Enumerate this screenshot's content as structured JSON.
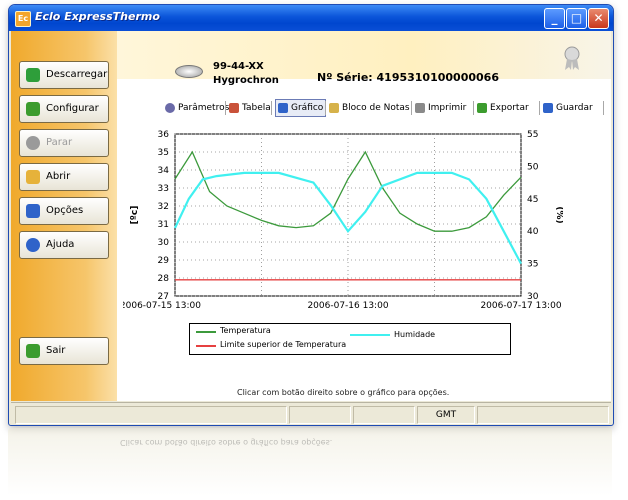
{
  "window": {
    "title": "Eclo ExpressThermo",
    "app_icon": "Ec"
  },
  "title_buttons": {
    "minimize": "_",
    "maximize": "□",
    "close": "✕"
  },
  "sidebar": {
    "items": [
      {
        "label": "Descarregar",
        "icon": "download-icon",
        "color": "#2e9e3a"
      },
      {
        "label": "Configurar",
        "icon": "configure-icon",
        "color": "#3c9c2e"
      },
      {
        "label": "Parar",
        "icon": "stop-icon",
        "color": "#9a9a9a",
        "disabled": true
      },
      {
        "label": "Abrir",
        "icon": "open-folder-icon",
        "color": "#e6b23a"
      },
      {
        "label": "Opções",
        "icon": "options-checkbox-icon",
        "color": "#2f63c9"
      },
      {
        "label": "Ajuda",
        "icon": "help-icon",
        "color": "#2f63c9"
      }
    ],
    "exit_label": "Sair"
  },
  "device": {
    "id": "99-44-XX",
    "name": "Hygrochron",
    "serial": "Nº Série: 4195310100000066"
  },
  "toolbar": {
    "items": [
      {
        "label": "Parâmetros",
        "icon": "gear-icon",
        "color": "#6a6aa8"
      },
      {
        "label": "Tabela",
        "icon": "table-icon",
        "color": "#c9523a"
      },
      {
        "label": "Gráfico",
        "icon": "chart-icon",
        "color": "#2f63c9",
        "active": true
      },
      {
        "label": "Bloco de Notas",
        "icon": "notepad-icon",
        "color": "#d6b24a"
      },
      {
        "label": "Imprimir",
        "icon": "printer-icon",
        "color": "#8a8a8a"
      },
      {
        "label": "Exportar",
        "icon": "export-icon",
        "color": "#3c9c2e"
      },
      {
        "label": "Guardar",
        "icon": "save-icon",
        "color": "#2f63c9"
      }
    ]
  },
  "chart_data": {
    "type": "line",
    "x_ticks": [
      "2006-07-15 13:00",
      "2006-07-16 13:00",
      "2006-07-17 13:00"
    ],
    "y_left": {
      "label": "[ºc]",
      "min": 27,
      "max": 36,
      "ticks": [
        27,
        28,
        29,
        30,
        31,
        32,
        33,
        34,
        35,
        36
      ]
    },
    "y_right": {
      "label": "(%)",
      "min": 30,
      "max": 55,
      "ticks": [
        30,
        35,
        40,
        45,
        50,
        55
      ]
    },
    "grid": true,
    "series": [
      {
        "name": "Temperatura",
        "axis": "left",
        "color": "#3c9a3c",
        "x": [
          0.0,
          0.05,
          0.1,
          0.15,
          0.2,
          0.25,
          0.3,
          0.35,
          0.4,
          0.45,
          0.5,
          0.55,
          0.6,
          0.65,
          0.7,
          0.75,
          0.8,
          0.85,
          0.9,
          0.95,
          1.0
        ],
        "y": [
          33.5,
          35.0,
          32.8,
          32.0,
          31.6,
          31.2,
          30.9,
          30.8,
          30.9,
          31.6,
          33.5,
          35.0,
          33.0,
          31.6,
          31.0,
          30.6,
          30.6,
          30.8,
          31.4,
          32.6,
          33.6
        ]
      },
      {
        "name": "Humidade",
        "axis": "right",
        "color": "#40f0f0",
        "x": [
          0.0,
          0.04,
          0.08,
          0.12,
          0.2,
          0.3,
          0.4,
          0.45,
          0.5,
          0.55,
          0.6,
          0.7,
          0.8,
          0.85,
          0.9,
          0.95,
          1.0
        ],
        "y": [
          40.5,
          45.0,
          48.0,
          48.5,
          49.0,
          49.0,
          47.5,
          44.0,
          40.0,
          43.0,
          47.0,
          49.0,
          49.0,
          48.0,
          45.0,
          40.0,
          35.0
        ]
      },
      {
        "name": "Limite superior de Temperatura",
        "axis": "left",
        "color": "#e64040",
        "x": [
          0.0,
          1.0
        ],
        "y": [
          27.9,
          27.9
        ]
      }
    ]
  },
  "hint": "Clicar com botão direito sobre o gráfico para opções.",
  "status": {
    "cells": [
      "",
      "",
      "",
      "GMT",
      ""
    ]
  }
}
